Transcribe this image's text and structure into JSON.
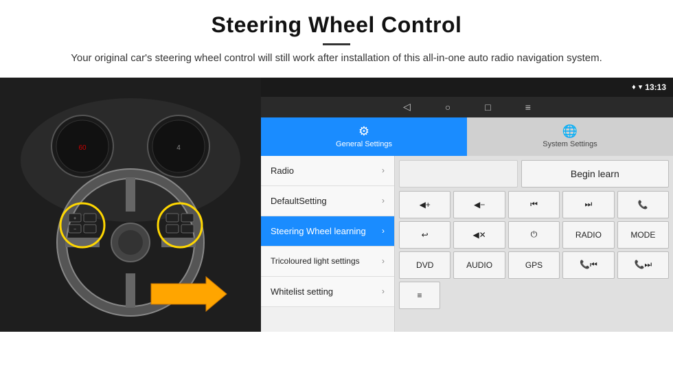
{
  "header": {
    "title": "Steering Wheel Control",
    "subtitle": "Your original car's steering wheel control will still work after installation of this all-in-one auto radio navigation system."
  },
  "status_bar": {
    "time": "13:13",
    "wifi_icon": "▾",
    "signal_icon": "◆"
  },
  "nav_bar": {
    "back_icon": "◁",
    "home_icon": "○",
    "recent_icon": "□",
    "menu_icon": "≡"
  },
  "tabs": [
    {
      "label": "General Settings",
      "active": true
    },
    {
      "label": "System Settings",
      "active": false
    }
  ],
  "menu_items": [
    {
      "label": "Radio",
      "active": false
    },
    {
      "label": "DefaultSetting",
      "active": false
    },
    {
      "label": "Steering Wheel learning",
      "active": true
    },
    {
      "label": "Tricoloured light settings",
      "active": false
    },
    {
      "label": "Whitelist setting",
      "active": false
    }
  ],
  "begin_learn_label": "Begin learn",
  "control_buttons": {
    "row1": [
      "🔊+",
      "🔊−",
      "⏮",
      "⏭",
      "📞"
    ],
    "row2": [
      "↩",
      "🔇",
      "⏻",
      "RADIO",
      "MODE"
    ],
    "row3": [
      "DVD",
      "AUDIO",
      "GPS",
      "📞⏮",
      "📞⏭"
    ]
  },
  "button_labels": {
    "vol_up": "◀+",
    "vol_down": "◀−",
    "prev_track": "⏮",
    "next_track": "⏭",
    "call": "📞",
    "hang_up": "↩",
    "mute": "✕",
    "power": "⏻",
    "radio": "RADIO",
    "mode": "MODE",
    "dvd": "DVD",
    "audio": "AUDIO",
    "gps": "GPS",
    "call_prev": "📞⏮",
    "call_next": "📞⏭"
  }
}
